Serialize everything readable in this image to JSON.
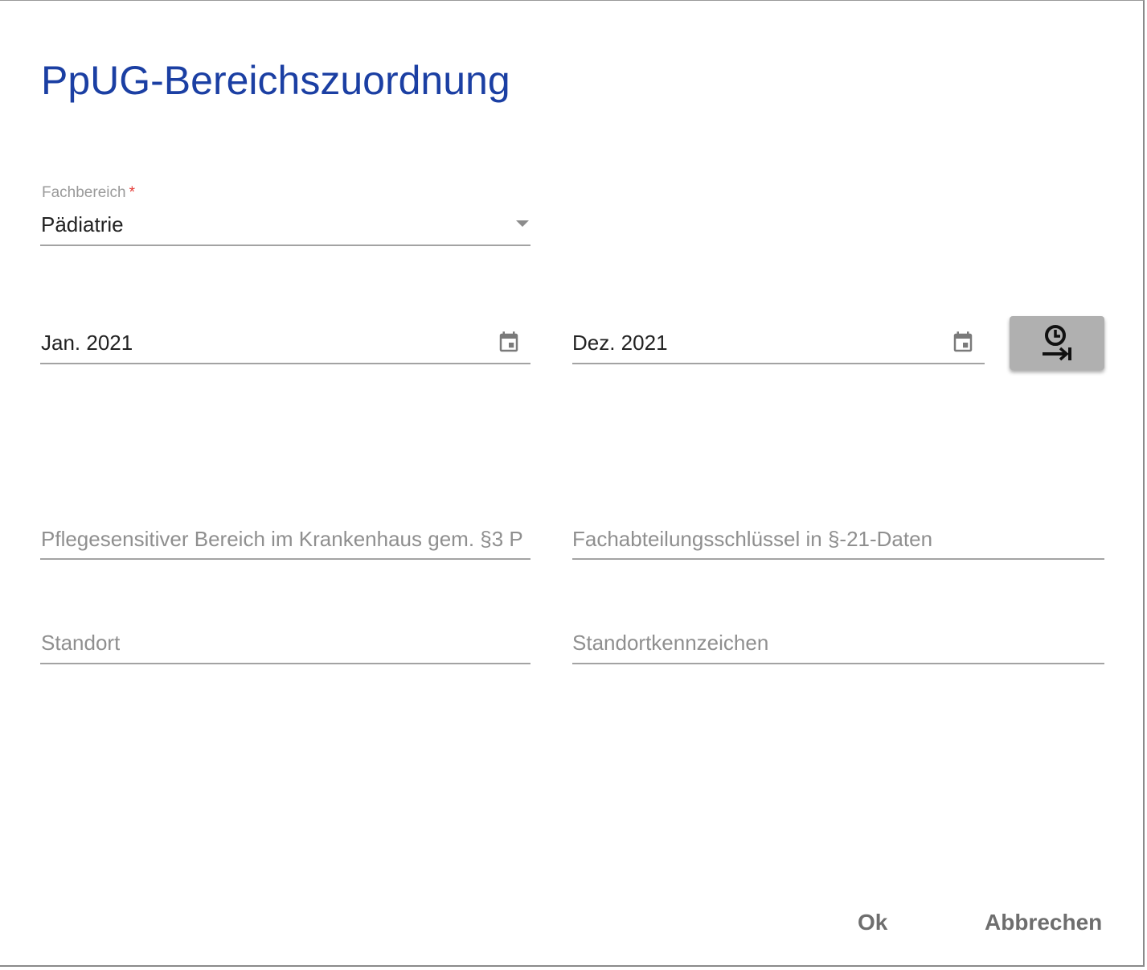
{
  "dialog": {
    "title": "PpUG-Bereichszuordnung"
  },
  "fachbereich": {
    "label": "Fachbereich",
    "required_marker": "*",
    "value": "Pädiatrie"
  },
  "date_from": {
    "value": "Jan. 2021",
    "icon": "calendar-icon"
  },
  "date_to": {
    "value": "Dez. 2021",
    "icon": "calendar-icon"
  },
  "actions": {
    "time_button_icon": "clock-arrow-end-icon"
  },
  "fields": {
    "pflegesensitiver_placeholder": "Pflegesensitiver Bereich im Krankenhaus gem. §3 P",
    "fachabteilung_placeholder": "Fachabteilungsschlüssel in §-21-Daten",
    "standort_placeholder": "Standort",
    "standortkennzeichen_placeholder": "Standortkennzeichen"
  },
  "footer": {
    "ok_label": "Ok",
    "cancel_label": "Abbrechen"
  }
}
